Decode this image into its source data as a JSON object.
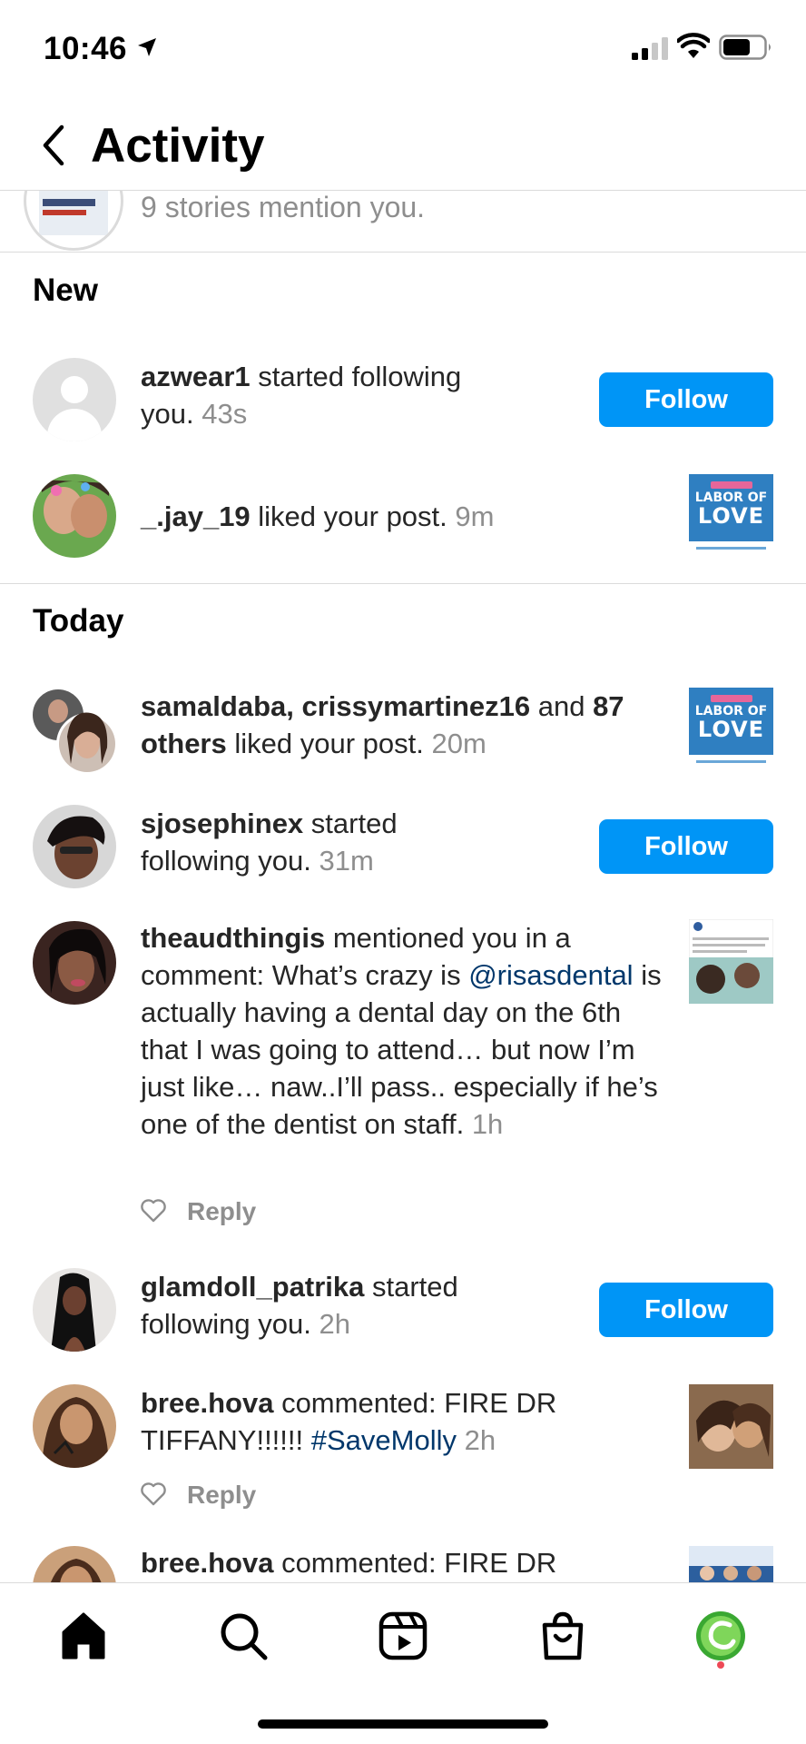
{
  "status_bar": {
    "time": "10:46"
  },
  "header": {
    "title": "Activity"
  },
  "stories": {
    "text": "9 stories mention you."
  },
  "sections": {
    "new": "New",
    "today": "Today"
  },
  "new_items": [
    {
      "username": "azwear1",
      "action": " started following you.",
      "time": "43s",
      "button": "Follow"
    },
    {
      "username": "_.jay_19",
      "action": " liked your post.",
      "time": "9m",
      "thumb_title": "LABOR OF",
      "thumb_word": "LOVE"
    }
  ],
  "today_items": [
    {
      "user1": "samaldaba",
      "user2": "crissymartinez16",
      "and": " and ",
      "others": "87 others",
      "action": " liked your post.",
      "time": "20m",
      "sep": ", ",
      "thumb_title": "LABOR OF",
      "thumb_word": "LOVE"
    },
    {
      "username": "sjosephinex",
      "action": " started following you.",
      "time": "31m",
      "button": "Follow"
    },
    {
      "username": "theaudthingis",
      "action_pre": " mentioned you in a comment: What’s crazy is ",
      "mention": "@risasdental",
      "action_post": " is actually having a dental day on the 6th that I was going to attend… but now I’m just like… naw..I’ll pass.. especially if he’s one of the dentist on staff.",
      "time": "1h",
      "reply": "Reply"
    },
    {
      "username": "glamdoll_patrika",
      "action": " started following you.",
      "time": "2h",
      "button": "Follow"
    },
    {
      "username": "bree.hova",
      "action": " commented: FIRE DR TIFFANY!!!!!! ",
      "hashtag": "#SaveMolly",
      "time": "2h",
      "reply": "Reply"
    },
    {
      "username": "bree.hova",
      "action": " commented: FIRE DR"
    }
  ],
  "tabs": [
    "home-icon",
    "search-icon",
    "reels-icon",
    "shop-icon",
    "profile-icon"
  ],
  "colors": {
    "follow_blue": "#0095f6",
    "link": "#00376b",
    "notification_dot": "#ed4956"
  }
}
